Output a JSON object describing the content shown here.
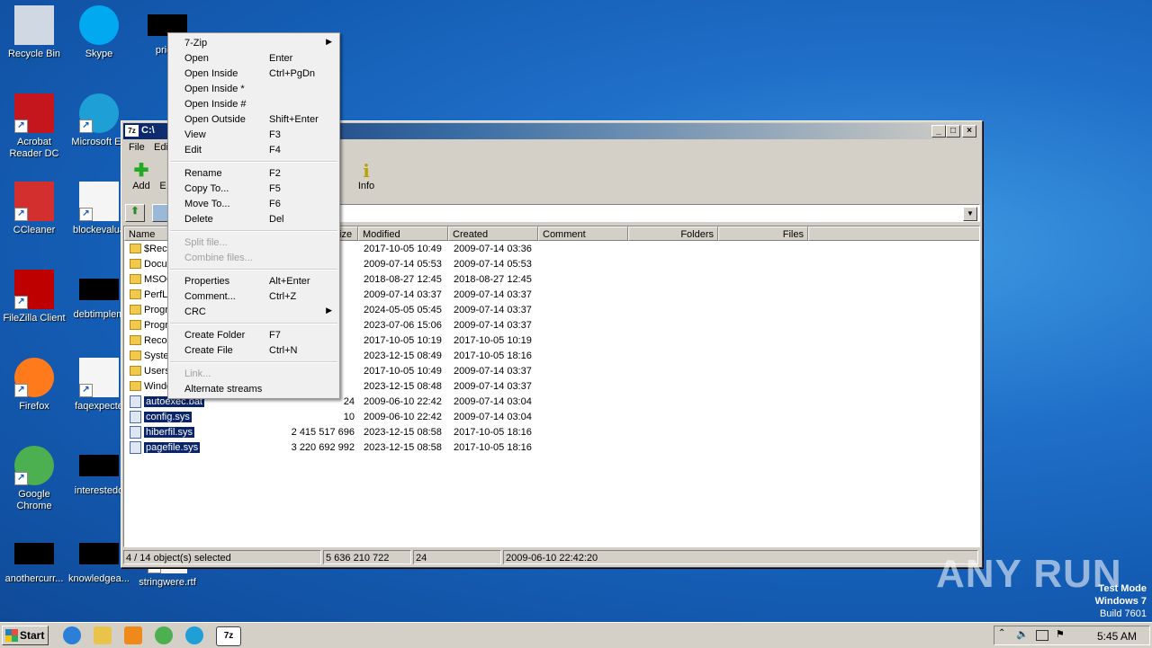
{
  "desktop": {
    "icons": [
      {
        "label": "Recycle Bin",
        "icon": "recycle-bin-icon"
      },
      {
        "label": "Skype",
        "icon": "skype-icon"
      },
      {
        "label": "pricel",
        "icon": "redacted-icon"
      },
      {
        "label": "Acrobat Reader DC",
        "icon": "acrobat-icon"
      },
      {
        "label": "Microsoft Ed",
        "icon": "edge-icon"
      },
      {
        "label": "CCleaner",
        "icon": "ccleaner-icon"
      },
      {
        "label": "blockevalua",
        "icon": "word-doc-icon"
      },
      {
        "label": "FileZilla Client",
        "icon": "filezilla-icon"
      },
      {
        "label": "debtimplem",
        "icon": "redacted-icon"
      },
      {
        "label": "Firefox",
        "icon": "firefox-icon"
      },
      {
        "label": "faqexpecte",
        "icon": "word-doc-icon"
      },
      {
        "label": "Google Chrome",
        "icon": "chrome-icon"
      },
      {
        "label": "interestedo",
        "icon": "redacted-icon"
      },
      {
        "label": "anothercurr...",
        "icon": "redacted-icon"
      },
      {
        "label": "knowledgea...",
        "icon": "redacted-icon"
      },
      {
        "label": "stringwere.rtf",
        "icon": "rtf-doc-icon"
      }
    ]
  },
  "window": {
    "title": "C:\\",
    "menu": [
      "File",
      "Edi"
    ],
    "toolbar": [
      {
        "label": "Add",
        "icon": "plus-icon"
      },
      {
        "label": "E",
        "icon": "extract-icon"
      },
      {
        "label": "e",
        "icon": "delete-icon"
      },
      {
        "label": "Info",
        "icon": "info-icon"
      }
    ],
    "columns": [
      "Name",
      "ize",
      "Modified",
      "Created",
      "Comment",
      "Folders",
      "Files"
    ],
    "rows": [
      {
        "name": "$Recy",
        "size": "",
        "modified": "2017-10-05 10:49",
        "created": "2009-07-14 03:36",
        "type": "folder",
        "selected": false
      },
      {
        "name": "Docu",
        "size": "",
        "modified": "2009-07-14 05:53",
        "created": "2009-07-14 05:53",
        "type": "folder",
        "selected": false
      },
      {
        "name": "MSOC",
        "size": "",
        "modified": "2018-08-27 12:45",
        "created": "2018-08-27 12:45",
        "type": "folder",
        "selected": false
      },
      {
        "name": "PerfL",
        "size": "",
        "modified": "2009-07-14 03:37",
        "created": "2009-07-14 03:37",
        "type": "folder",
        "selected": false
      },
      {
        "name": "Progr",
        "size": "",
        "modified": "2024-05-05 05:45",
        "created": "2009-07-14 03:37",
        "type": "folder",
        "selected": false
      },
      {
        "name": "Progr",
        "size": "",
        "modified": "2023-07-06 15:06",
        "created": "2009-07-14 03:37",
        "type": "folder",
        "selected": false
      },
      {
        "name": "Reco",
        "size": "",
        "modified": "2017-10-05 10:19",
        "created": "2017-10-05 10:19",
        "type": "folder",
        "selected": false
      },
      {
        "name": "Syste",
        "size": "",
        "modified": "2023-12-15 08:49",
        "created": "2017-10-05 18:16",
        "type": "folder",
        "selected": false
      },
      {
        "name": "Users",
        "size": "",
        "modified": "2017-10-05 10:49",
        "created": "2009-07-14 03:37",
        "type": "folder",
        "selected": false
      },
      {
        "name": "Windo",
        "size": "",
        "modified": "2023-12-15 08:48",
        "created": "2009-07-14 03:37",
        "type": "folder",
        "selected": false
      },
      {
        "name": "autoexec.bat",
        "size": "24",
        "modified": "2009-06-10 22:42",
        "created": "2009-07-14 03:04",
        "type": "file",
        "selected": true
      },
      {
        "name": "config.sys",
        "size": "10",
        "modified": "2009-06-10 22:42",
        "created": "2009-07-14 03:04",
        "type": "file",
        "selected": true
      },
      {
        "name": "hiberfil.sys",
        "size": "2 415 517 696",
        "modified": "2023-12-15 08:58",
        "created": "2017-10-05 18:16",
        "type": "file",
        "selected": true
      },
      {
        "name": "pagefile.sys",
        "size": "3 220 692 992",
        "modified": "2023-12-15 08:58",
        "created": "2017-10-05 18:16",
        "type": "file",
        "selected": true
      }
    ],
    "status": {
      "selection": "4 / 14 object(s) selected",
      "total_size": "5 636 210 722",
      "selected_size": "24",
      "date": "2009-06-10 22:42:20"
    }
  },
  "context_menu": {
    "items": [
      {
        "label": "7-Zip",
        "shortcut": "",
        "submenu": true,
        "disabled": false
      },
      {
        "label": "Open",
        "shortcut": "Enter",
        "submenu": false,
        "disabled": false
      },
      {
        "label": "Open Inside",
        "shortcut": "Ctrl+PgDn",
        "submenu": false,
        "disabled": false
      },
      {
        "label": "Open Inside *",
        "shortcut": "",
        "submenu": false,
        "disabled": false
      },
      {
        "label": "Open Inside #",
        "shortcut": "",
        "submenu": false,
        "disabled": false
      },
      {
        "label": "Open Outside",
        "shortcut": "Shift+Enter",
        "submenu": false,
        "disabled": false
      },
      {
        "label": "View",
        "shortcut": "F3",
        "submenu": false,
        "disabled": false
      },
      {
        "label": "Edit",
        "shortcut": "F4",
        "submenu": false,
        "disabled": false
      },
      {
        "separator": true
      },
      {
        "label": "Rename",
        "shortcut": "F2",
        "submenu": false,
        "disabled": false
      },
      {
        "label": "Copy To...",
        "shortcut": "F5",
        "submenu": false,
        "disabled": false
      },
      {
        "label": "Move To...",
        "shortcut": "F6",
        "submenu": false,
        "disabled": false
      },
      {
        "label": "Delete",
        "shortcut": "Del",
        "submenu": false,
        "disabled": false
      },
      {
        "separator": true
      },
      {
        "label": "Split file...",
        "shortcut": "",
        "submenu": false,
        "disabled": true
      },
      {
        "label": "Combine files...",
        "shortcut": "",
        "submenu": false,
        "disabled": true
      },
      {
        "separator": true
      },
      {
        "label": "Properties",
        "shortcut": "Alt+Enter",
        "submenu": false,
        "disabled": false
      },
      {
        "label": "Comment...",
        "shortcut": "Ctrl+Z",
        "submenu": false,
        "disabled": false
      },
      {
        "label": "CRC",
        "shortcut": "",
        "submenu": true,
        "disabled": false
      },
      {
        "separator": true
      },
      {
        "label": "Create Folder",
        "shortcut": "F7",
        "submenu": false,
        "disabled": false
      },
      {
        "label": "Create File",
        "shortcut": "Ctrl+N",
        "submenu": false,
        "disabled": false
      },
      {
        "separator": true
      },
      {
        "label": "Link...",
        "shortcut": "",
        "submenu": false,
        "disabled": true
      },
      {
        "label": "Alternate streams",
        "shortcut": "",
        "submenu": false,
        "disabled": false
      }
    ]
  },
  "taskbar": {
    "start_label": "Start",
    "apps": [
      "ie-icon",
      "explorer-icon",
      "media-player-icon",
      "chrome-icon",
      "edge-icon",
      "7zip-icon"
    ],
    "active_app_label": "7z",
    "clock": "5:45 AM"
  },
  "watermark": "ANY RUN",
  "testmode": {
    "line1": "Test Mode",
    "line2": "Windows 7",
    "line3": "Build 7601"
  }
}
